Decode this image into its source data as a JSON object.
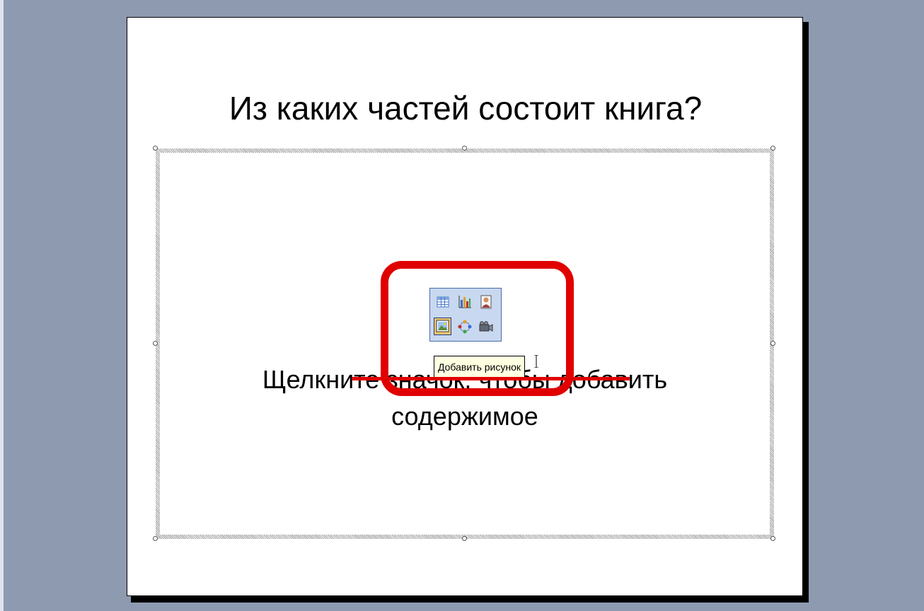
{
  "slide": {
    "title": "Из каких частей состоит книга?",
    "body_line1": "Щелкните значок, чтобы добавить",
    "body_line2": "содержимое"
  },
  "content_icons": [
    {
      "name": "insert-table-icon"
    },
    {
      "name": "insert-chart-icon"
    },
    {
      "name": "insert-clip-art-icon"
    },
    {
      "name": "insert-picture-icon"
    },
    {
      "name": "insert-diagram-icon"
    },
    {
      "name": "insert-media-clip-icon"
    }
  ],
  "tooltip": {
    "text": "Добавить рисунок"
  },
  "colors": {
    "background": "#8e9ab0",
    "slide": "#ffffff",
    "annotation": "#e00000",
    "tooltip_bg": "#ffffe1",
    "icon_panel": "#c8d8f0"
  }
}
